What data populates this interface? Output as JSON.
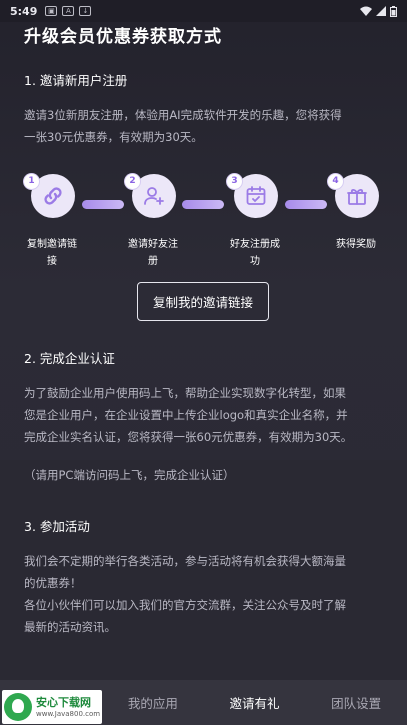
{
  "status_bar": {
    "time": "5:49",
    "icons": [
      "app-icon",
      "a-icon",
      "download-icon"
    ]
  },
  "page_title": "升级会员优惠券获取方式",
  "section1": {
    "title": "1. 邀请新用户注册",
    "lines": [
      "邀请3位新朋友注册，体验用AI完成软件开发的乐趣，您将获得",
      "一张30元优惠券，有效期为30天。"
    ],
    "steps": [
      {
        "num": "1",
        "icon": "link-icon",
        "label_lines": [
          "复制邀请链",
          "接"
        ]
      },
      {
        "num": "2",
        "icon": "add-user-icon",
        "label_lines": [
          "邀请好友注",
          "册"
        ]
      },
      {
        "num": "3",
        "icon": "calendar-check-icon",
        "label_lines": [
          "好友注册成",
          "功"
        ]
      },
      {
        "num": "4",
        "icon": "gift-icon",
        "label_lines": [
          "获得奖励"
        ]
      }
    ],
    "copy_button": "复制我的邀请链接"
  },
  "section2": {
    "title": "2. 完成企业认证",
    "lines": [
      "为了鼓励企业用户使用码上飞，帮助企业实现数字化转型，如果",
      "您是企业用户，在企业设置中上传企业logo和真实企业名称，并",
      "完成企业实名认证，您将获得一张60元优惠券，有效期为30天。",
      "（请用PC端访问码上飞，完成企业认证）"
    ]
  },
  "section3": {
    "title": "3. 参加活动",
    "lines": [
      "我们会不定期的举行各类活动，参与活动将有机会获得大额海量",
      "的优惠券！",
      "各位小伙伴们可以加入我们的官方交流群，关注公众号及时了解",
      "最新的活动资讯。"
    ]
  },
  "tabbar": {
    "tabs": [
      "我的应用",
      "邀请有礼",
      "团队设置"
    ],
    "active": "邀请有礼"
  },
  "watermark": {
    "main": "安心下载网",
    "sub": "www.Java800.com"
  },
  "colors": {
    "accent": "#8a63e3",
    "background": "#2b2a35"
  }
}
